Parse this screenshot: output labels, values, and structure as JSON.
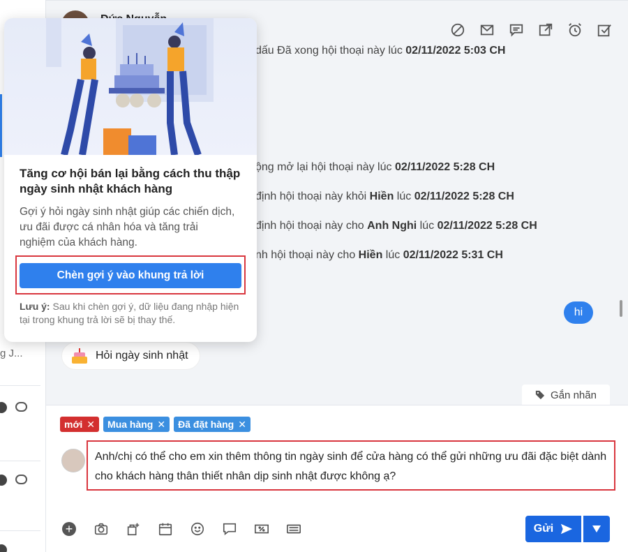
{
  "colors": {
    "accent": "#2f80ed",
    "send": "#1a66e0",
    "highlight": "#d9363e",
    "tag_new": "#d32f2f",
    "tag_blue": "#3b8fe0"
  },
  "header": {
    "contact_name": "Đức Nguyễn",
    "icons": [
      "block-icon",
      "mail-icon",
      "comment-icon",
      "external-link-icon",
      "alarm-icon",
      "check-square-icon"
    ]
  },
  "logs": [
    {
      "prefix": "dấu Đã xong hội thoại này lúc ",
      "time": "02/11/2022 5:03 CH"
    },
    {
      "prefix": "ộng mở lại hội thoại này lúc ",
      "time": "02/11/2022 5:28 CH"
    },
    {
      "prefix": "định hội thoại này khỏi ",
      "who": "Hiền",
      "mid": " lúc ",
      "time": "02/11/2022 5:28 CH"
    },
    {
      "prefix": "định hội thoại này cho ",
      "who": "Anh Nghi",
      "mid": " lúc ",
      "time": "02/11/2022 5:28 CH"
    },
    {
      "prefix": "nh hội thoại này cho ",
      "who": "Hiền",
      "mid": " lúc ",
      "time": "02/11/2022 5:31 CH"
    }
  ],
  "chat": {
    "outgoing_message": "hi",
    "suggestion_chip": "Hỏi ngày sinh nhật",
    "tag_tab": "Gắn nhãn"
  },
  "tags": [
    {
      "label": "mới",
      "color": "#d32f2f"
    },
    {
      "label": "Mua hàng",
      "color": "#3b8fe0"
    },
    {
      "label": "Đã đặt hàng",
      "color": "#3b8fe0"
    }
  ],
  "composer": {
    "reply_text": "Anh/chị có thể cho em xin thêm thông tin ngày sinh để cửa hàng có thể gửi những ưu đãi đặc biệt dành cho khách hàng thân thiết nhân dịp sinh nhật được không ạ?",
    "send_label": "Gửi",
    "toolbar_icons": [
      "add-icon",
      "camera-icon",
      "product-icon",
      "calendar-icon",
      "emoji-icon",
      "quick-reply-icon",
      "discount-icon",
      "keyboard-icon"
    ]
  },
  "popup": {
    "title": "Tăng cơ hội bán lại bằng cách thu thập ngày sinh nhật khách hàng",
    "description": "Gợi ý hỏi ngày sinh nhật giúp các chiến dịch, ưu đãi được cá nhân hóa và tăng trải nghiệm của khách hàng.",
    "insert_button": "Chèn gợi ý vào khung trả lời",
    "note_label": "Lưu ý:",
    "note_text": " Sau khi chèn gợi ý, dữ liệu đang nhập hiện tại trong khung trả lời sẽ bị thay thế."
  },
  "sidebar": {
    "snippet": "g J..."
  }
}
